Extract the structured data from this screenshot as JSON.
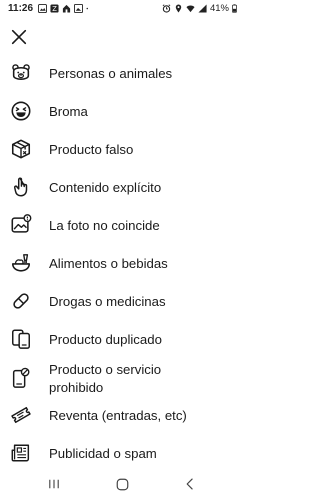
{
  "status_bar": {
    "time": "11:26",
    "battery": "41%"
  },
  "close_icon": "close-icon",
  "menu": {
    "items": [
      {
        "label": "Personas o animales",
        "icon": "bear-face-icon"
      },
      {
        "label": "Broma",
        "icon": "laughing-face-icon"
      },
      {
        "label": "Producto falso",
        "icon": "box-icon"
      },
      {
        "label": "Contenido explícito",
        "icon": "hand-gesture-icon"
      },
      {
        "label": "La foto no coincide",
        "icon": "image-alert-icon"
      },
      {
        "label": "Alimentos o bebidas",
        "icon": "food-icon"
      },
      {
        "label": "Drogas o medicinas",
        "icon": "pill-icon"
      },
      {
        "label": "Producto duplicado",
        "icon": "duplicate-phone-icon"
      },
      {
        "label": "Producto o servicio",
        "label2": "prohibido",
        "icon": "prohibited-phone-icon"
      },
      {
        "label": "Reventa (entradas, etc)",
        "icon": "ticket-icon"
      },
      {
        "label": "Publicidad o spam",
        "icon": "newspaper-icon"
      }
    ]
  }
}
